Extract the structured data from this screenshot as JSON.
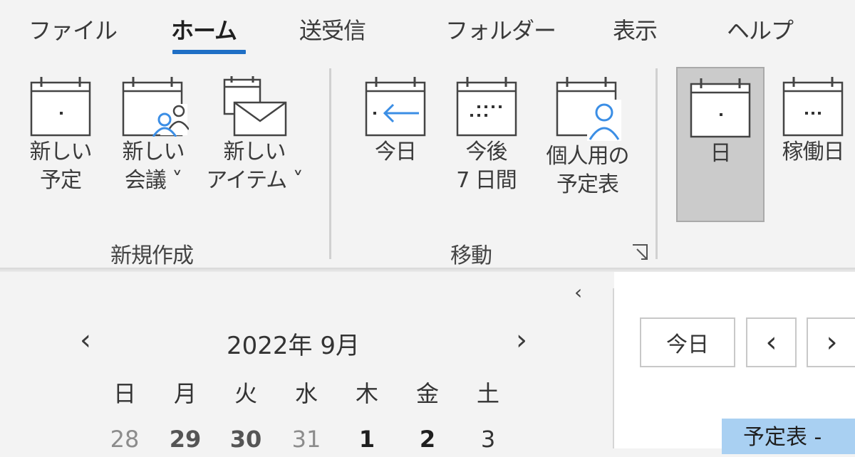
{
  "tabs": [
    "ファイル",
    "ホーム",
    "送受信",
    "フォルダー",
    "表示",
    "ヘルプ"
  ],
  "active_tab": "ホーム",
  "ribbon": {
    "new_group": {
      "label": "新規作成",
      "new_appointment": {
        "line1": "新しい",
        "line2": "予定"
      },
      "new_meeting": {
        "line1": "新しい",
        "line2": "会議 ˅"
      },
      "new_item": {
        "line1": "新しい",
        "line2": "アイテム ˅"
      }
    },
    "goto_group": {
      "label": "移動",
      "today": {
        "line1": "今日"
      },
      "next7": {
        "line1": "今後",
        "line2": "7 日間"
      },
      "personal": {
        "line1": "個人用の",
        "line2": "予定表"
      }
    },
    "arrange_group": {
      "day": {
        "line1": "日"
      },
      "work_week": {
        "line1": "稼働日"
      }
    }
  },
  "navigation": {
    "collapse_glyph": "‹",
    "prev_glyph": "‹",
    "next_glyph": "›",
    "month_title": "2022年 9月",
    "weekdays": [
      "日",
      "月",
      "火",
      "水",
      "木",
      "金",
      "土"
    ],
    "first_week": [
      "28",
      "29",
      "30",
      "31",
      "1",
      "2",
      "3"
    ]
  },
  "calendar": {
    "today_button": "今日",
    "prev_glyph": "‹",
    "next_glyph": "›",
    "schedule_tab": "予定表 -"
  },
  "colors": {
    "accent": "#1f6fc5",
    "icon_blue": "#3b8ee5",
    "selected_tab": "#a9d0f2"
  }
}
